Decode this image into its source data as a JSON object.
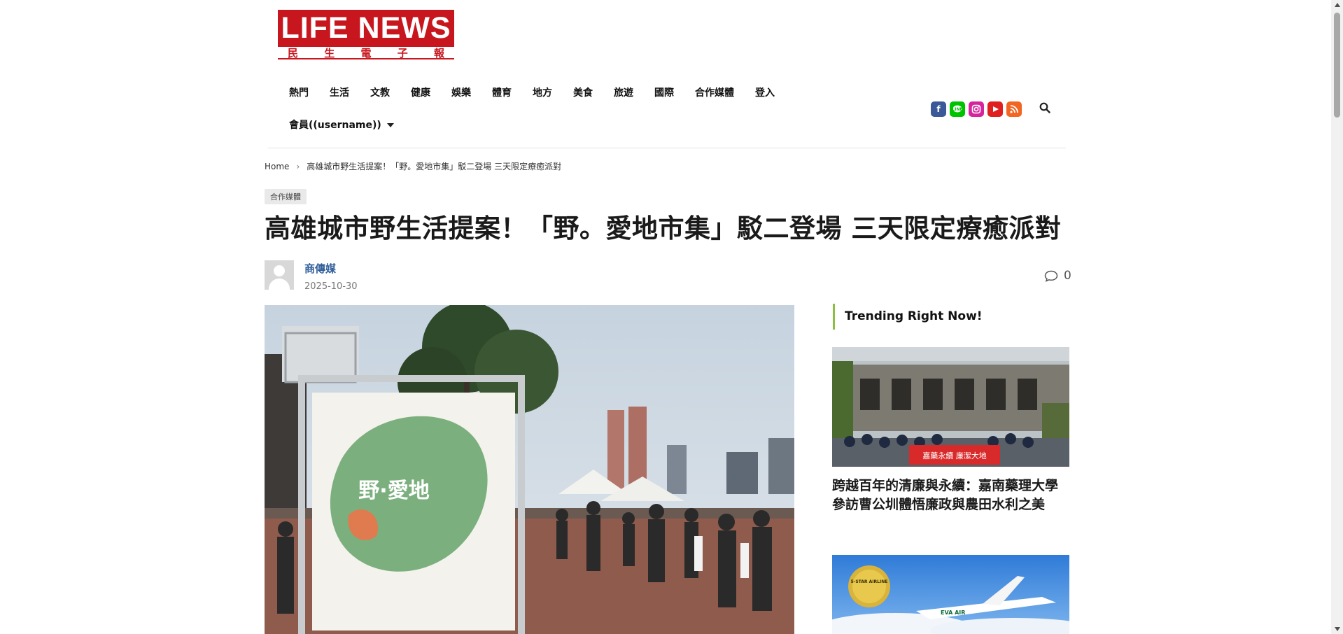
{
  "logo": {
    "main": "LIFE NEWS",
    "sub_chars": [
      "民",
      "生",
      "電",
      "子",
      "報"
    ]
  },
  "nav": {
    "items": [
      "熱門",
      "生活",
      "文教",
      "健康",
      "娛樂",
      "體育",
      "地方",
      "美食",
      "旅遊",
      "國際",
      "合作媒體",
      "登入"
    ],
    "member": "會員((username))"
  },
  "socials": [
    {
      "name": "facebook-icon",
      "glyph": "f"
    },
    {
      "name": "line-icon",
      "glyph": "L"
    },
    {
      "name": "instagram-icon",
      "glyph": "◎"
    },
    {
      "name": "youtube-icon",
      "glyph": "▶"
    },
    {
      "name": "rss-icon",
      "glyph": ")"
    }
  ],
  "breadcrumb": {
    "home": "Home",
    "sep": "›",
    "current": "高雄城市野生活提案！「野。愛地市集」駁二登場 三天限定療癒派對"
  },
  "article": {
    "category": "合作媒體",
    "title": "高雄城市野生活提案！「野。愛地市集」駁二登場 三天限定療癒派對",
    "author": "商傳媒",
    "date": "2025-10-30",
    "comment_count": "0",
    "hero_sign_text": "野·愛地"
  },
  "sidebar": {
    "heading": "Trending Right Now!",
    "items": [
      {
        "title": "跨越百年的清廉與永續：嘉南藥理大學參訪曹公圳體悟廉政與農田水利之美",
        "banner": "嘉藥永續 廉潔大地"
      },
      {
        "title": "",
        "badge": "5-STAR AIRLINE",
        "brand": "EVA AIR"
      }
    ]
  },
  "colors": {
    "brand_red": "#c7161e",
    "link_blue": "#2f5d9a",
    "trending_accent": "#8bbf3f"
  }
}
